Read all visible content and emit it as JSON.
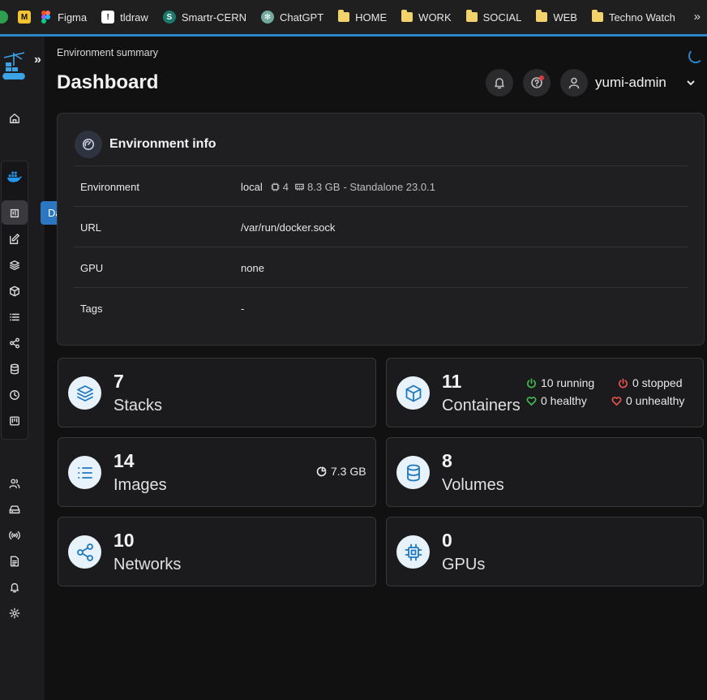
{
  "bookmarks": [
    {
      "label": "",
      "icon": "green-extension-icon"
    },
    {
      "label": "",
      "icon": "yellow-app-icon"
    },
    {
      "label": "Figma",
      "icon": "figma-icon"
    },
    {
      "label": "tldraw",
      "icon": "tldraw-icon"
    },
    {
      "label": "Smartr-CERN",
      "icon": "smartr-icon"
    },
    {
      "label": "ChatGPT",
      "icon": "chatgpt-icon"
    },
    {
      "label": "HOME",
      "icon": "folder-icon"
    },
    {
      "label": "WORK",
      "icon": "folder-icon"
    },
    {
      "label": "SOCIAL",
      "icon": "folder-icon"
    },
    {
      "label": "WEB",
      "icon": "folder-icon"
    },
    {
      "label": "Techno Watch",
      "icon": "folder-icon"
    }
  ],
  "bookmarks_more": "»",
  "sidebar": {
    "tooltip": "Dashboard"
  },
  "header": {
    "breadcrumb": "Environment summary",
    "title": "Dashboard",
    "username": "yumi-admin"
  },
  "env_info": {
    "title": "Environment info",
    "rows": [
      {
        "key": "Environment",
        "value": "local",
        "cpu": "4",
        "memory": "8.3 GB",
        "suffix": "- Standalone 23.0.1"
      },
      {
        "key": "URL",
        "value": "/var/run/docker.sock"
      },
      {
        "key": "GPU",
        "value": "none"
      },
      {
        "key": "Tags",
        "value": "-"
      }
    ]
  },
  "cards": {
    "stacks": {
      "count": "7",
      "label": "Stacks"
    },
    "containers": {
      "count": "11",
      "label": "Containers",
      "running": "10 running",
      "stopped": "0 stopped",
      "healthy": "0 healthy",
      "unhealthy": "0 unhealthy"
    },
    "images": {
      "count": "14",
      "label": "Images",
      "size": "7.3 GB"
    },
    "volumes": {
      "count": "8",
      "label": "Volumes"
    },
    "networks": {
      "count": "10",
      "label": "Networks"
    },
    "gpus": {
      "count": "0",
      "label": "GPUs"
    }
  },
  "colors": {
    "accent": "#2a86c9",
    "running": "#3fb950",
    "stopped": "#e5534b",
    "icon_blue": "#1f78c1"
  }
}
